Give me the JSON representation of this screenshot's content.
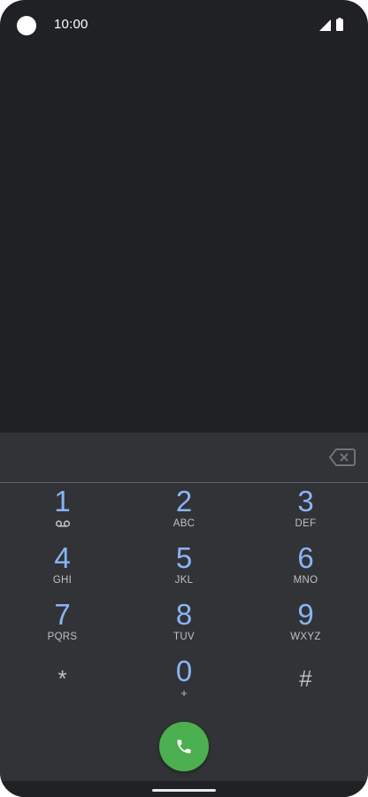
{
  "status_bar": {
    "time": "10:00",
    "icons": [
      "camera-dot",
      "signal-icon",
      "battery-icon"
    ]
  },
  "dialer": {
    "number_value": "",
    "backspace_icon": "backspace-icon",
    "keys": [
      {
        "digit": "1",
        "letters": "",
        "extra": "voicemail-icon"
      },
      {
        "digit": "2",
        "letters": "ABC"
      },
      {
        "digit": "3",
        "letters": "DEF"
      },
      {
        "digit": "4",
        "letters": "GHI"
      },
      {
        "digit": "5",
        "letters": "JKL"
      },
      {
        "digit": "6",
        "letters": "MNO"
      },
      {
        "digit": "7",
        "letters": "PQRS"
      },
      {
        "digit": "8",
        "letters": "TUV"
      },
      {
        "digit": "9",
        "letters": "WXYZ"
      },
      {
        "digit": "*",
        "letters": ""
      },
      {
        "digit": "0",
        "letters": "+"
      },
      {
        "digit": "#",
        "letters": ""
      }
    ],
    "call_icon": "phone-icon"
  },
  "colors": {
    "background": "#202124",
    "panel": "#323336",
    "digit": "#8ab4f8",
    "letters": "#bdc1c6",
    "call_button": "#4caf50"
  }
}
